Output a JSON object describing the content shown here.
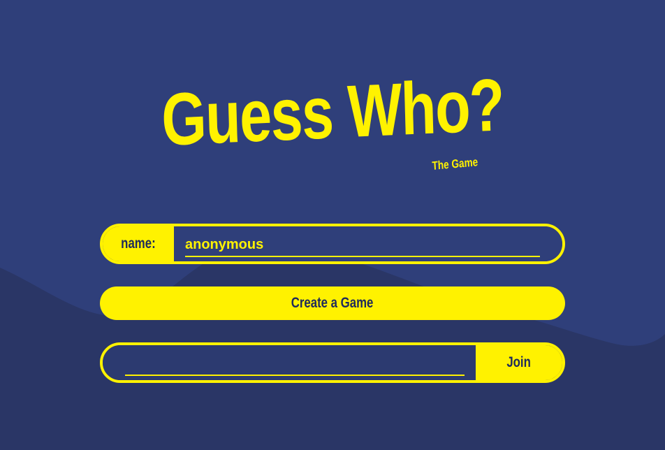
{
  "header": {
    "title": "Guess Who?",
    "subtitle": "The Game"
  },
  "name_row": {
    "label": "name:",
    "value": "anonymous",
    "placeholder": ""
  },
  "create_button": {
    "label": "Create a Game"
  },
  "join_row": {
    "value": "",
    "placeholder": "",
    "button_label": "Join"
  },
  "colors": {
    "background": "#2f3f7a",
    "background_wave": "#2a3666",
    "accent": "#fff200",
    "text_dark": "#1e2a5c"
  }
}
